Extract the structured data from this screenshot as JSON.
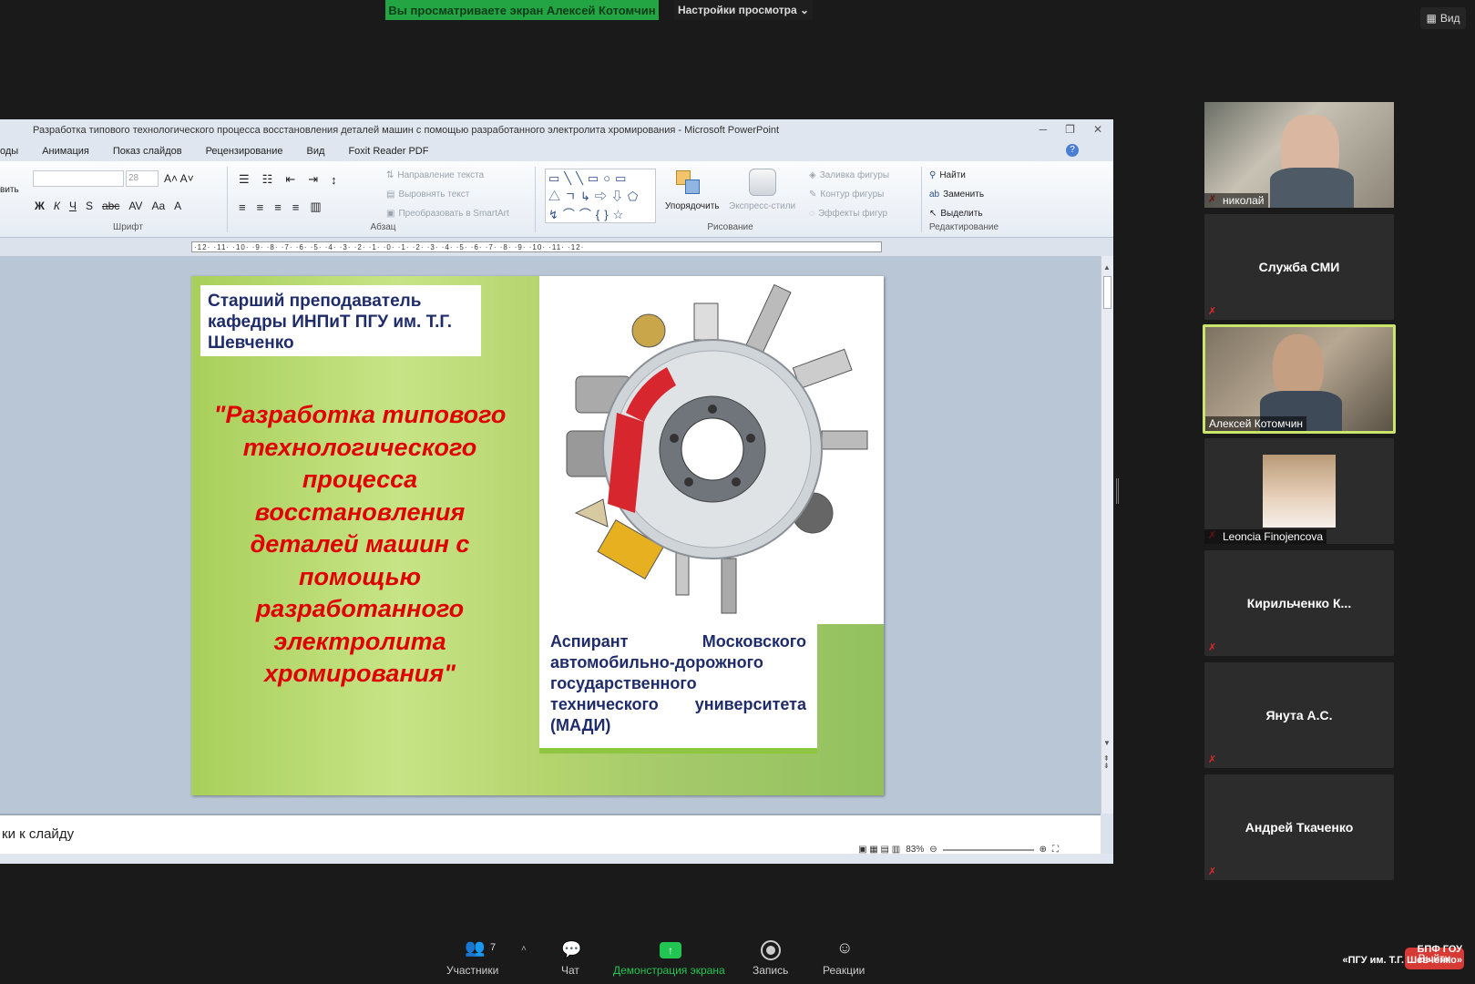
{
  "zoom_banner": {
    "viewing": "Вы просматриваете экран Алексей Котомчин",
    "settings": "Настройки просмотра ⌄",
    "view": "Вид"
  },
  "ppt": {
    "title": "Разработка типового технологического процесса восстановления деталей машин с помощью разработанного электролита хромирования - Microsoft PowerPoint",
    "tabs": [
      "оды",
      "Анимация",
      "Показ слайдов",
      "Рецензирование",
      "Вид",
      "Foxit Reader PDF"
    ],
    "ribbon": {
      "font_group": "Шрифт",
      "paragraph_group": "Абзац",
      "drawing_group": "Рисование",
      "editing_group": "Редактирование",
      "text_direction": "Направление текста",
      "align_text": "Выровнять текст",
      "smartart": "Преобразовать в SmartArt",
      "arrange": "Упорядочить",
      "quick_styles": "Экспресс-стили",
      "shape_fill": "Заливка фигуры",
      "shape_outline": "Контур фигуры",
      "shape_effects": "Эффекты фигур",
      "find": "Найти",
      "replace": "Заменить",
      "select": "Выделить",
      "paste_partial": "вить",
      "font_size": "28"
    },
    "ruler": "·12· ·11· ·10· ·9· ·8· ·7· ·6· ·5· ·4· ·3· ·2· ·1· ·0· ·1· ·2· ·3· ·4· ·5· ·6· ·7· ·8· ·9· ·10· ·11· ·12·",
    "slide": {
      "teacher": "Старший преподаватель кафедры ИНПиТ ПГУ им. Т.Г. Шевченко",
      "title": "\"Разработка типового технологического процесса восстановления деталей машин с помощью разработанного электролита хромирования\"",
      "aspirant": "Аспирант Московского автомобильно-дорожного государственного технического университета (МАДИ)"
    },
    "notes": "ки к слайду",
    "zoom_level": "83%"
  },
  "participants": [
    {
      "name": "николай",
      "video": true,
      "muted": true
    },
    {
      "name": "Служба СМИ",
      "video": false,
      "muted": true
    },
    {
      "name": "Алексей Котомчин",
      "video": true,
      "muted": false,
      "active": true
    },
    {
      "name": "Leoncia Finojencova",
      "video": true,
      "muted": true
    },
    {
      "name": "Кирильченко  К...",
      "video": false,
      "muted": true
    },
    {
      "name": "Янута А.С.",
      "video": false,
      "muted": true
    },
    {
      "name": "Андрей Ткаченко",
      "video": false,
      "muted": true
    }
  ],
  "toolbar": {
    "participants_label": "Участники",
    "participants_count": "7",
    "chat": "Чат",
    "share": "Демонстрация экрана",
    "record": "Запись",
    "reactions": "Реакции",
    "leave": "Выйти"
  },
  "watermark": {
    "line1": "БПФ ГОУ",
    "line2": "«ПГУ им. Т.Г. Шевченко»"
  },
  "colors": {
    "zoom_green": "#23a543",
    "active_border": "#c9e56b",
    "title_red": "#e00000",
    "text_navy": "#1f2c6b"
  }
}
